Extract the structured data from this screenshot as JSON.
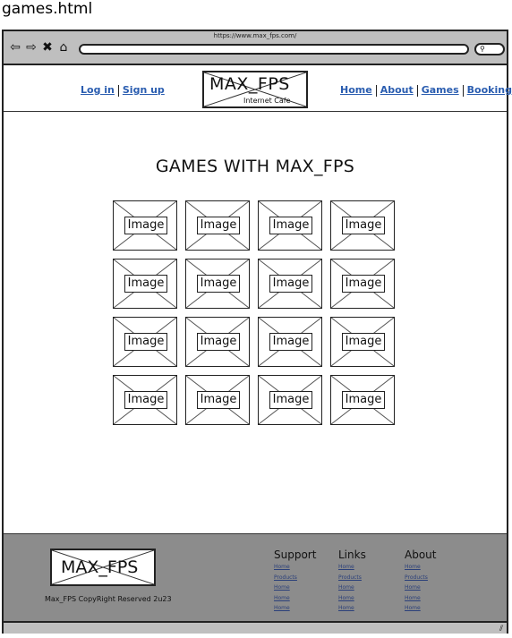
{
  "file_title": "games.html",
  "browser": {
    "url": "https://www.max_fps.com/",
    "nav_icons": [
      "back-arrow-icon",
      "forward-arrow-icon",
      "close-icon",
      "home-icon"
    ],
    "back_glyph": "⇦",
    "forward_glyph": "⇨",
    "close_glyph": "✖",
    "home_glyph": "⌂",
    "search_glyph": "⚲"
  },
  "header": {
    "auth": {
      "login": "Log in",
      "signup": "Sign up"
    },
    "logo": {
      "title": "MAX_FPS",
      "subtitle": "Internet Cafe"
    },
    "nav": {
      "home": "Home",
      "about": "About",
      "games": "Games",
      "booking": "Booking"
    }
  },
  "main": {
    "heading": "GAMES WITH MAX_FPS",
    "tile_label": "Image"
  },
  "footer": {
    "logo_title": "MAX_FPS",
    "copyright": "Max_FPS CopyRight Reserved 2u23",
    "support": {
      "title": "Support",
      "links": [
        "Home",
        "Products",
        "Home",
        "Home",
        "Home"
      ]
    },
    "links": {
      "title": "Links",
      "links": [
        "Home",
        "Products",
        "Home",
        "Home",
        "Home"
      ]
    },
    "about": {
      "title": "About",
      "links": [
        "Home",
        "Products",
        "Home",
        "Home",
        "Home"
      ]
    }
  },
  "statusbar": {
    "grip_glyph": "⫽"
  },
  "colors": {
    "link": "#2a5db0",
    "chrome": "#bfbfbf",
    "footer": "#8c8c8c"
  }
}
